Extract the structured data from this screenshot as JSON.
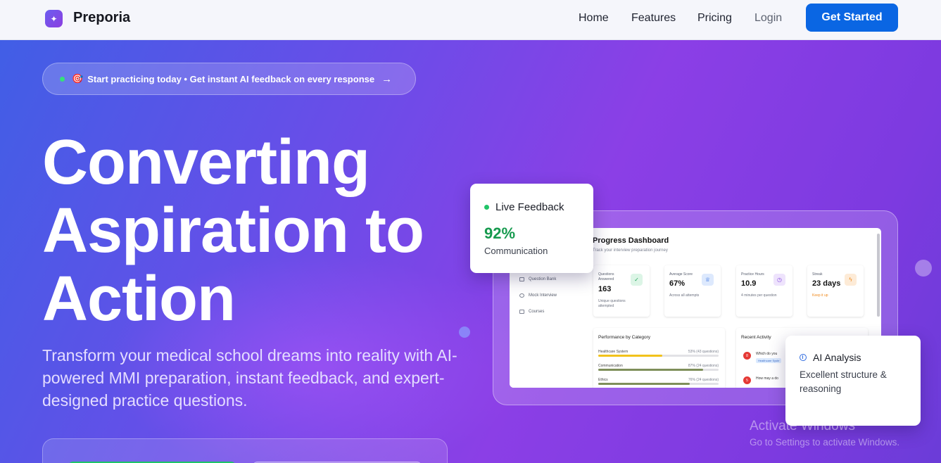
{
  "nav": {
    "brand": "Preporia",
    "logo_icon": "sparkle-icon",
    "links": [
      "Home",
      "Features",
      "Pricing",
      "Login"
    ],
    "cta": "Get Started"
  },
  "announcement": {
    "icon": "target-icon",
    "text": "Start practicing today • Get instant AI feedback on every response",
    "arrow": "→"
  },
  "hero": {
    "title_lines": [
      "Converting",
      "Aspiration to",
      "Action"
    ],
    "subtitle": "Transform your medical school dreams into reality with AI-powered MMI preparation, instant feedback, and expert-designed practice questions."
  },
  "dashboard": {
    "title": "Progress Dashboard",
    "subtitle": "Track your interview preparation journey",
    "sidebar": [
      "Question Bank",
      "Mock Interview",
      "Courses"
    ],
    "stats": [
      {
        "label": "Questions Answered",
        "value": "163",
        "note": "Unique questions attempted",
        "icon": "check-circle-icon",
        "color": "#22a55a",
        "bg": "#dcf5e6"
      },
      {
        "label": "Average Score",
        "value": "67%",
        "note": "Across all attempts",
        "icon": "award-icon",
        "color": "#2f6be0",
        "bg": "#dde9fd"
      },
      {
        "label": "Practice Hours",
        "value": "10.9",
        "note": "4 minutes per question",
        "icon": "clock-icon",
        "color": "#8a4fe0",
        "bg": "#eee3fc"
      },
      {
        "label": "Streak",
        "value": "23 days",
        "note": "Keep it up",
        "icon": "lightning-icon",
        "color": "#f08a1c",
        "bg": "#fdebd7"
      }
    ],
    "performance": {
      "title": "Performance by Category",
      "items": [
        {
          "name": "Healthcare System",
          "pct": "53% (43 questions)",
          "fill": 0.53,
          "color": "#f2c21b"
        },
        {
          "name": "Communication",
          "pct": "87% (24 questions)",
          "fill": 0.87,
          "color": "#7f8f5a"
        },
        {
          "name": "Ethics",
          "pct": "76% (24 questions)",
          "fill": 0.76,
          "color": "#7f8f5a"
        }
      ]
    },
    "activity": {
      "title": "Recent Activity",
      "items": [
        {
          "n": "8",
          "text": "Which do you",
          "tag": "Healthcare Syste"
        },
        {
          "n": "5",
          "text": "How may a do",
          "tag": ""
        }
      ]
    }
  },
  "live_feedback": {
    "title": "Live Feedback",
    "score": "92%",
    "label": "Communication"
  },
  "ai_analysis": {
    "title": "AI Analysis",
    "text": "Excellent structure & reasoning"
  },
  "watermark": {
    "line1": "Activate Windows",
    "line2": "Go to Settings to activate Windows."
  }
}
